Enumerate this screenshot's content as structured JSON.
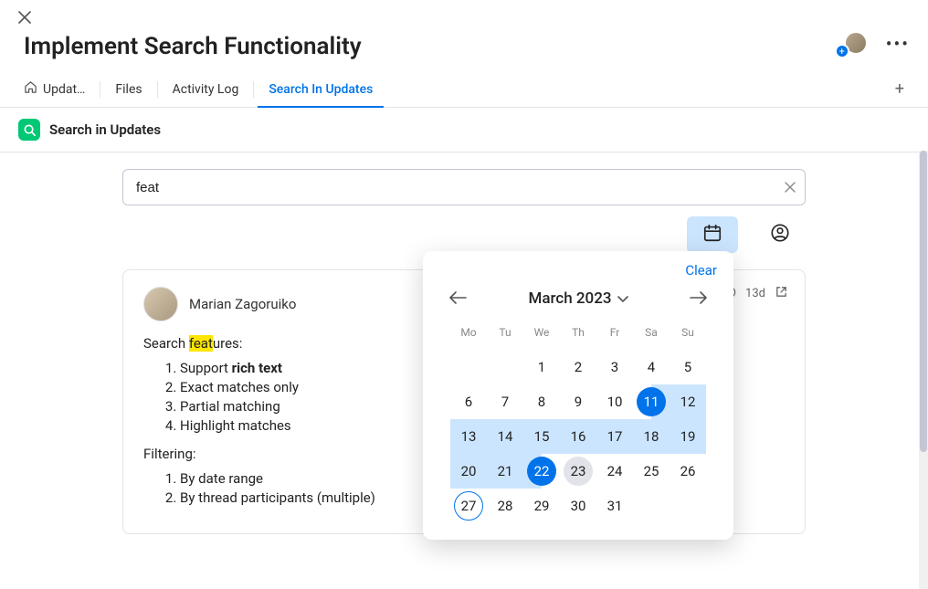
{
  "header": {
    "title": "Implement Search Functionality"
  },
  "tabs": {
    "updates": "Updat…",
    "files": "Files",
    "activity": "Activity Log",
    "search": "Search In Updates"
  },
  "section": {
    "title": "Search in Updates"
  },
  "search": {
    "value": "feat"
  },
  "datepicker": {
    "clear": "Clear",
    "month_label": "March 2023",
    "dow": [
      "Mo",
      "Tu",
      "We",
      "Th",
      "Fr",
      "Sa",
      "Su"
    ],
    "weeks": [
      [
        "",
        "",
        "1",
        "2",
        "3",
        "4",
        "5"
      ],
      [
        "6",
        "7",
        "8",
        "9",
        "10",
        "11",
        "12"
      ],
      [
        "13",
        "14",
        "15",
        "16",
        "17",
        "18",
        "19"
      ],
      [
        "20",
        "21",
        "22",
        "23",
        "24",
        "25",
        "26"
      ],
      [
        "27",
        "28",
        "29",
        "30",
        "31",
        "",
        ""
      ]
    ],
    "range_start": 11,
    "range_end": 22,
    "hover_day": 23,
    "today": 27
  },
  "post": {
    "author": "Marian Zagoruiko",
    "age": "13d",
    "intro_pre": "Search ",
    "intro_hl": "feat",
    "intro_post": "ures:",
    "list1": {
      "i1a": "Support ",
      "i1b": "rich text",
      "i2": "Exact matches only",
      "i3": "Partial matching",
      "i4": "Highlight matches"
    },
    "filtering_label": "Filtering:",
    "list2": {
      "i1": "By date range",
      "i2": "By thread participants (multiple)"
    }
  }
}
